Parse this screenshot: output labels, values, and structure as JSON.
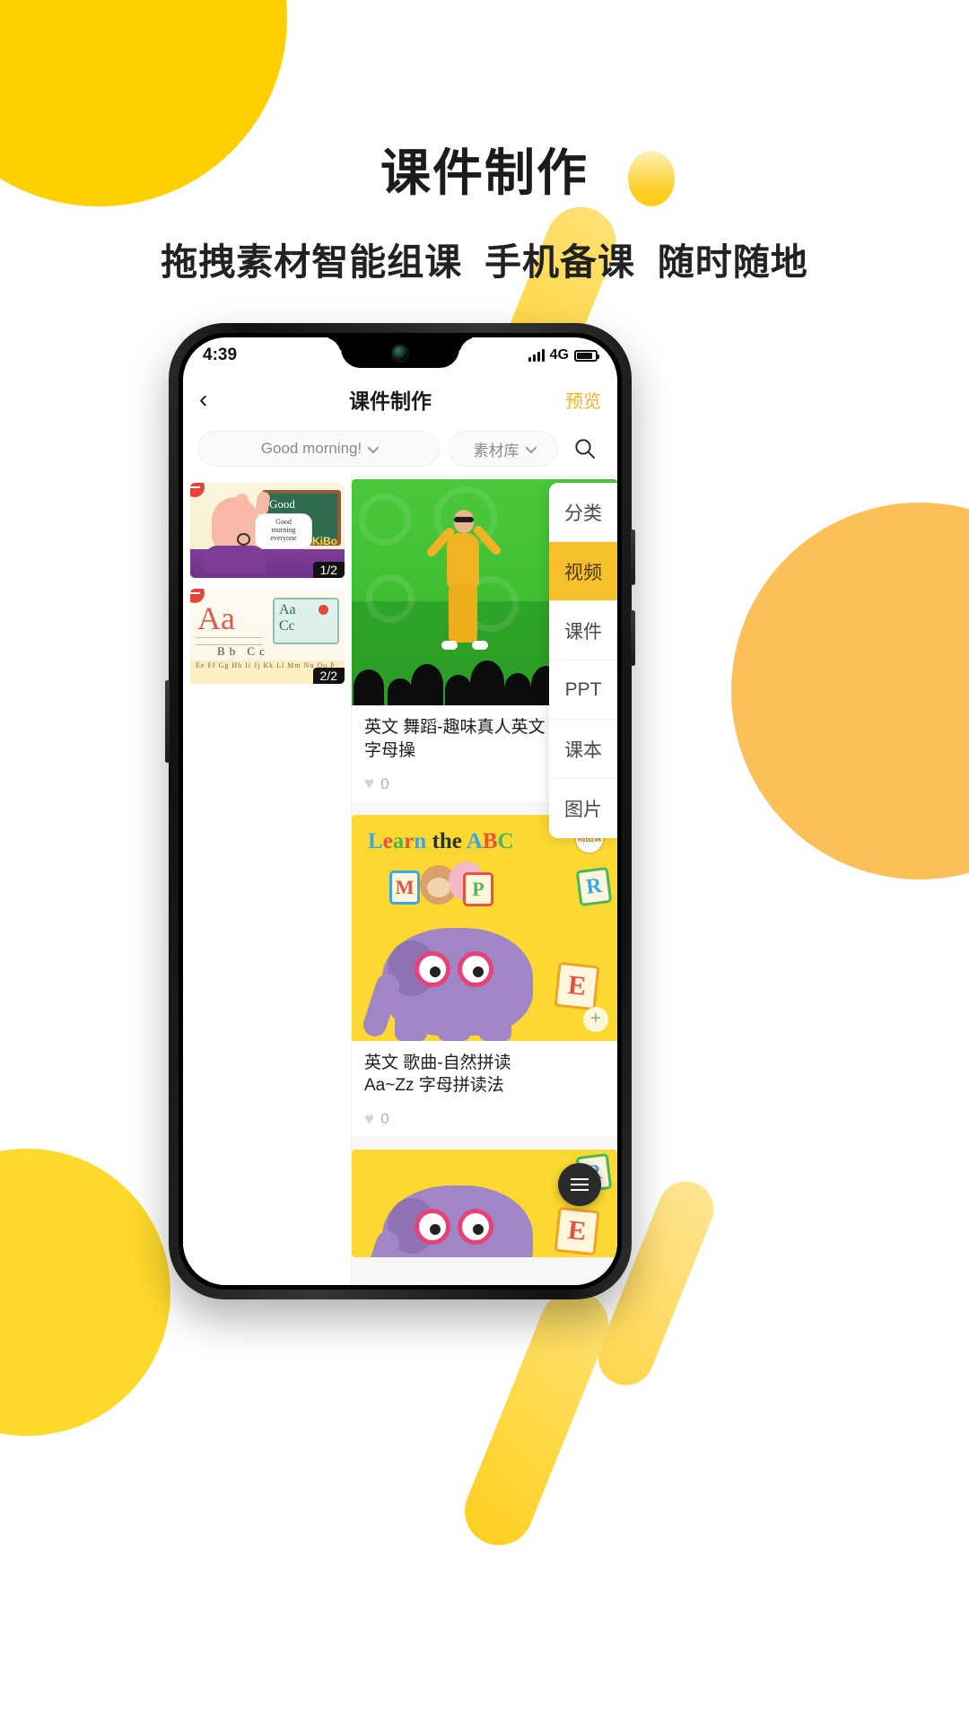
{
  "promo": {
    "headline": "课件制作",
    "subhead": "拖拽素材智能组课  手机备课  随时随地"
  },
  "theme": {
    "brand_yellow": "#FFD000",
    "accent_orange": "#FBC05A",
    "menu_active": "#F5C02B",
    "preview_link": "#F0B51F",
    "delete_red": "#E8423F"
  },
  "statusbar": {
    "time": "4:39",
    "network": "4G",
    "signal_icon": "signal-bars-icon",
    "battery_icon": "battery-icon"
  },
  "navbar": {
    "back_icon": "chevron-left-icon",
    "title": "课件制作",
    "preview_label": "预览"
  },
  "filters": {
    "lesson_select_value": "Good morning!",
    "lesson_chevron_icon": "chevron-down-icon",
    "library_select_value": "素材库",
    "library_chevron_icon": "chevron-down-icon",
    "search_icon": "search-icon"
  },
  "slides": [
    {
      "page_badge": "1/2",
      "delete_icon": "remove-circle-icon",
      "board_text": "Good\nMorning",
      "brand_text": "KiBo",
      "bubble_text": "Good morning everyone"
    },
    {
      "page_badge": "2/2",
      "delete_icon": "remove-circle-icon",
      "letter_big": "Aa",
      "card_letters": "Aa\nCc",
      "alphabet_row": "Ee Ff Gg Hh Ii Jj Kk Ll Mm Nn Oo P",
      "abc_row": "Bb Cc"
    }
  ],
  "materials": [
    {
      "thumb_kind": "video-dancer-greenscreen",
      "title": "英文 舞蹈-趣味真人英文\n字母操",
      "likes": "0",
      "heart_icon": "heart-icon"
    },
    {
      "thumb_kind": "song-elephant-abc",
      "thumb_text": "Learn the ABC",
      "tiles": [
        "M",
        "P",
        "R",
        "E"
      ],
      "title": "英文 歌曲-自然拼读\nAa~Zz 字母拼读法",
      "likes": "0",
      "heart_icon": "heart-icon",
      "stamp_text": "精品课",
      "add_icon": "plus-icon"
    },
    {
      "thumb_kind": "song-elephant-abc-partial",
      "tiles": [
        "R",
        "E"
      ]
    }
  ],
  "category_menu": {
    "items": [
      {
        "label": "分类",
        "active": false
      },
      {
        "label": "视频",
        "active": true
      },
      {
        "label": "课件",
        "active": false
      },
      {
        "label": "PPT",
        "active": false
      },
      {
        "label": "课本",
        "active": false
      },
      {
        "label": "图片",
        "active": false
      }
    ]
  },
  "fab": {
    "icon": "menu-list-icon"
  }
}
